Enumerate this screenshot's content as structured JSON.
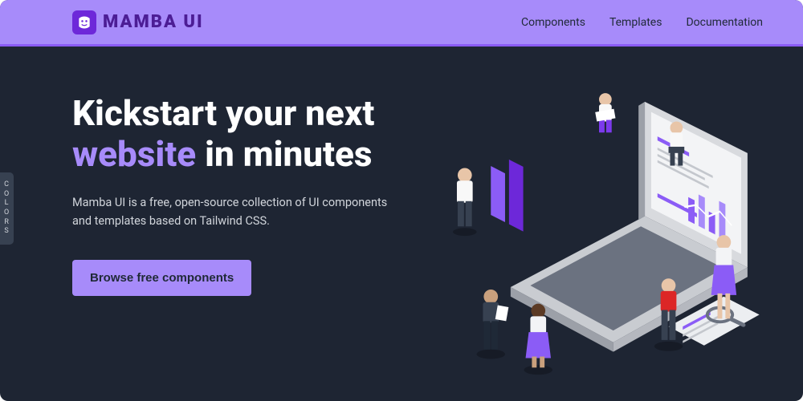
{
  "brand": {
    "name": "MAMBA UI"
  },
  "nav": {
    "items": [
      "Components",
      "Templates",
      "Documentation"
    ]
  },
  "hero": {
    "title_part1": "Kickstart your next ",
    "title_accent": "website",
    "title_part2": " in minutes",
    "description": "Mamba UI is a free, open-source collection of UI components and templates based on Tailwind CSS.",
    "cta_label": "Browse free components"
  },
  "sidebar": {
    "colors_label": "COLORS"
  },
  "colors": {
    "accent": "#a78bfa",
    "accent_dark": "#6d28d9",
    "bg": "#1e2533"
  }
}
